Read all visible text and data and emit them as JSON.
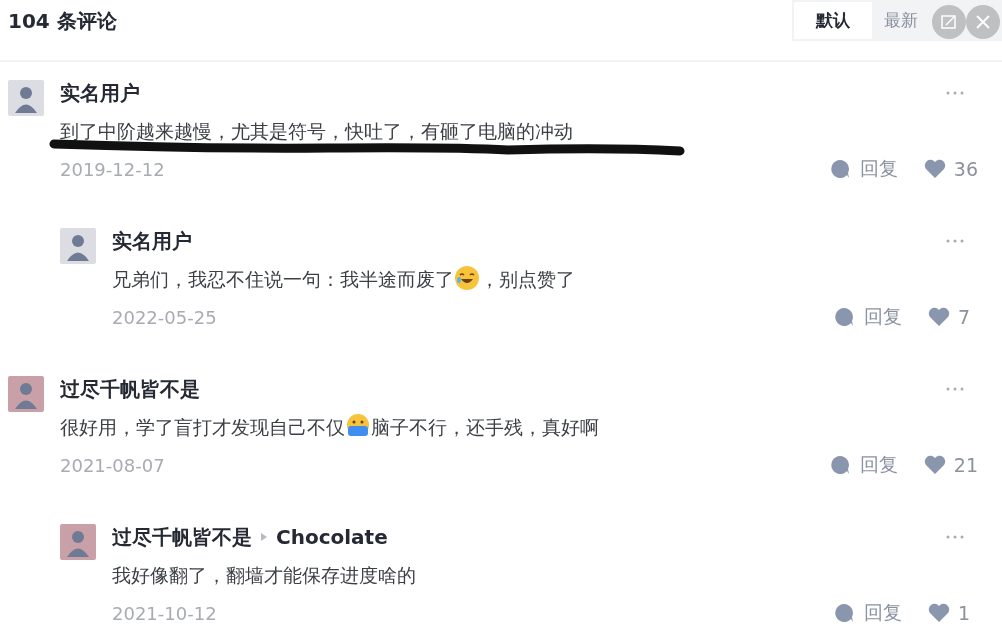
{
  "header": {
    "title": "104 条评论",
    "tabs": [
      {
        "label": "默认",
        "selected": true
      },
      {
        "label": "最新",
        "selected": false
      }
    ]
  },
  "comments": [
    {
      "user": "实名用户",
      "color": "#dcdde2",
      "segments": [
        {
          "kind": "text",
          "text": "到了中阶越来越慢，尤其是符号，快吐了，有砸了电脑的冲动"
        }
      ],
      "scribbled": true,
      "date": "2019-12-12",
      "reply_label": "回复",
      "likes": "36",
      "children": [
        {
          "user": "实名用户",
          "color": "#dcdde2",
          "segments": [
            {
              "kind": "text",
              "text": "兄弟们，我忍不住说一句：我半途而废了"
            },
            {
              "kind": "laughing"
            },
            {
              "kind": "text",
              "text": "，别点赞了"
            }
          ],
          "date": "2022-05-25",
          "reply_label": "回复",
          "likes": "7"
        }
      ]
    },
    {
      "user": "过尽千帆皆不是",
      "color": "#c9a0a8",
      "segments": [
        {
          "kind": "text",
          "text": "很好用，学了盲打才发现自己不仅"
        },
        {
          "kind": "masked"
        },
        {
          "kind": "text",
          "text": "脑子不行，还手残，真好啊"
        }
      ],
      "date": "2021-08-07",
      "reply_label": "回复",
      "likes": "21",
      "children": [
        {
          "user": "过尽千帆皆不是",
          "reply_to": "Chocolate",
          "color": "#c9a0a8",
          "segments": [
            {
              "kind": "text",
              "text": "我好像翻了，翻墙才能保存进度啥的"
            }
          ],
          "date": "2021-10-12",
          "reply_label": "回复",
          "likes": "1"
        }
      ]
    }
  ]
}
